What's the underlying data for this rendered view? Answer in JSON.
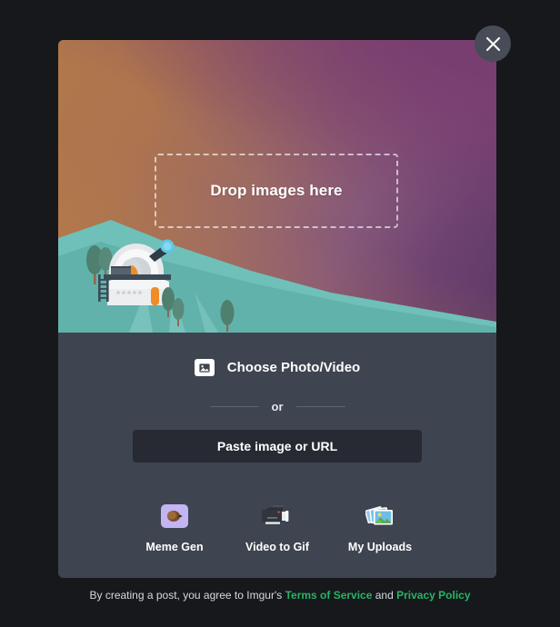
{
  "modal": {
    "close_label": "Close",
    "dropzone": {
      "text": "Drop images here"
    },
    "hero_illustration": "observatory-on-hillside-illustration",
    "choose": {
      "label": "Choose Photo/Video",
      "icon": "image-icon"
    },
    "divider": {
      "text": "or"
    },
    "paste": {
      "label": "Paste image or URL"
    },
    "tools": [
      {
        "label": "Meme Gen",
        "icon": "meme-gen-icon"
      },
      {
        "label": "Video to Gif",
        "icon": "camcorder-icon"
      },
      {
        "label": "My Uploads",
        "icon": "photo-stack-icon"
      }
    ]
  },
  "footer": {
    "prefix": "By creating a post, you agree to Imgur's ",
    "terms": "Terms of Service",
    "middle": " and ",
    "privacy": "Privacy Policy"
  },
  "colors": {
    "page_background": "#16181c",
    "panel_background": "#3e4450",
    "paste_button": "#272a33",
    "link_green": "#27b564",
    "close_button": "#474c56",
    "gradient_from": "#b0784b",
    "gradient_to": "#6d4170"
  }
}
